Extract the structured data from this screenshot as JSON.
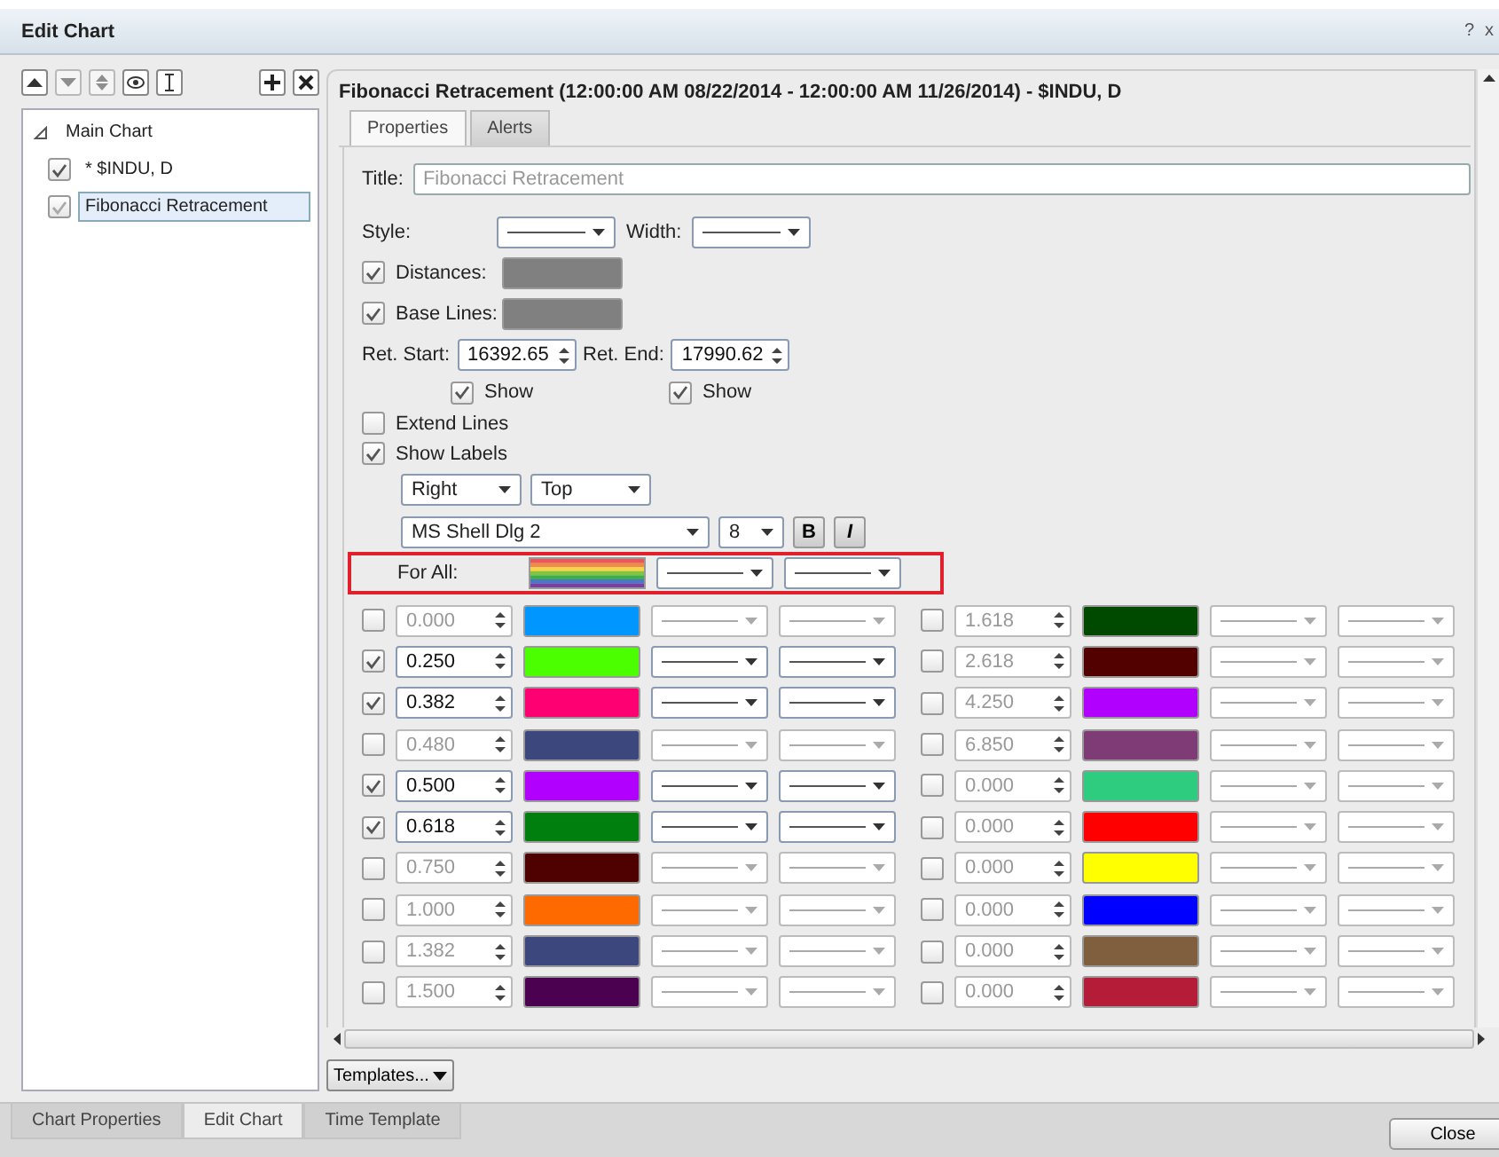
{
  "window": {
    "title": "Edit Chart",
    "help": "?",
    "close": "x"
  },
  "tree": [
    {
      "label": "Main Chart",
      "expanded": true,
      "children": [
        {
          "label": "* $INDU, D",
          "checked": true,
          "selected": false
        },
        {
          "label": "Fibonacci Retracement",
          "checked": true,
          "selected": true
        }
      ]
    }
  ],
  "study_title": "Fibonacci Retracement (12:00:00 AM 08/22/2014 - 12:00:00 AM 11/26/2014) - $INDU, D",
  "tabs": [
    {
      "label": "Properties",
      "selected": true
    },
    {
      "label": "Alerts",
      "selected": false
    }
  ],
  "form": {
    "title_label": "Title:",
    "title_placeholder": "Fibonacci Retracement",
    "style_label": "Style:",
    "width_label": "Width:",
    "distances": {
      "label": "Distances:",
      "checked": true
    },
    "base_lines": {
      "label": "Base Lines:",
      "checked": true
    },
    "ret_start_label": "Ret. Start:",
    "ret_start": "16392.65",
    "ret_end_label": "Ret. End:",
    "ret_end": "17990.62",
    "show_start": {
      "label": "Show",
      "checked": true
    },
    "show_end": {
      "label": "Show",
      "checked": true
    },
    "extend_lines": {
      "label": "Extend Lines",
      "checked": false
    },
    "show_labels": {
      "label": "Show Labels",
      "checked": true
    },
    "h_align": "Right",
    "v_align": "Top",
    "font": "MS Shell Dlg 2",
    "font_size": "8",
    "bold": "B",
    "italic": "I",
    "for_all_label": "For All:"
  },
  "levels": {
    "left": [
      {
        "checked": false,
        "value": "0.000",
        "color": "#0096ff"
      },
      {
        "checked": true,
        "value": "0.250",
        "color": "#4cff00"
      },
      {
        "checked": true,
        "value": "0.382",
        "color": "#ff0072"
      },
      {
        "checked": false,
        "value": "0.480",
        "color": "#3c477e"
      },
      {
        "checked": true,
        "value": "0.500",
        "color": "#b200ff"
      },
      {
        "checked": true,
        "value": "0.618",
        "color": "#007f0e"
      },
      {
        "checked": false,
        "value": "0.750",
        "color": "#4f0000"
      },
      {
        "checked": false,
        "value": "1.000",
        "color": "#ff6a00"
      },
      {
        "checked": false,
        "value": "1.382",
        "color": "#3c477e"
      },
      {
        "checked": false,
        "value": "1.500",
        "color": "#4c0050"
      }
    ],
    "right": [
      {
        "checked": false,
        "value": "1.618",
        "color": "#004a00"
      },
      {
        "checked": false,
        "value": "2.618",
        "color": "#520000"
      },
      {
        "checked": false,
        "value": "4.250",
        "color": "#b200ff"
      },
      {
        "checked": false,
        "value": "6.850",
        "color": "#7f3b76"
      },
      {
        "checked": false,
        "value": "0.000",
        "color": "#2ecc7f"
      },
      {
        "checked": false,
        "value": "0.000",
        "color": "#ff0000"
      },
      {
        "checked": false,
        "value": "0.000",
        "color": "#ffff00"
      },
      {
        "checked": false,
        "value": "0.000",
        "color": "#0000ff"
      },
      {
        "checked": false,
        "value": "0.000",
        "color": "#7f5f3d"
      },
      {
        "checked": false,
        "value": "0.000",
        "color": "#b41c38"
      }
    ]
  },
  "templates_button": "Templates...",
  "bottom_tabs": [
    {
      "label": "Chart Properties",
      "selected": false
    },
    {
      "label": "Edit Chart",
      "selected": true
    },
    {
      "label": "Time Template",
      "selected": false
    }
  ],
  "close_button": "Close"
}
